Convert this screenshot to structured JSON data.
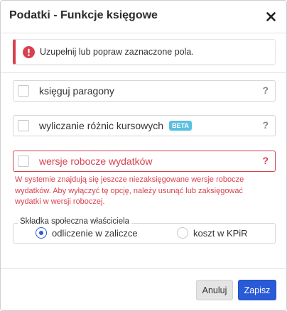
{
  "dialog": {
    "title": "Podatki - Funkcje księgowe"
  },
  "alert": {
    "text": "Uzupełnij lub popraw zaznaczone pola.",
    "color": "#d9404f"
  },
  "options": [
    {
      "label": "księguj paragony",
      "help": "?",
      "checked": false
    },
    {
      "label": "wyliczanie różnic kursowych",
      "badge": "BETA",
      "help": "?",
      "checked": false
    },
    {
      "label": "wersje robocze wydatków",
      "help": "?",
      "checked": false,
      "error": true
    }
  ],
  "error_message": "W systemie znajdują się jeszcze niezaksięgowane wersje robocze wydatków. Aby wyłączyć tę opcję, należy usunąć lub zaksięgować wydatki w wersji roboczej.",
  "contribution": {
    "legend": "Składka społeczna właściciela",
    "options": [
      {
        "label": "odliczenie w zaliczce",
        "selected": true
      },
      {
        "label": "koszt w KPiR",
        "selected": false
      }
    ]
  },
  "footer": {
    "cancel_label": "Anuluj",
    "save_label": "Zapisz"
  },
  "colors": {
    "primary": "#2a5bd7",
    "error": "#d9404f",
    "badge": "#5bc0de"
  },
  "icons": [
    "close-icon",
    "exclamation-circle-icon",
    "question-mark-icon"
  ]
}
